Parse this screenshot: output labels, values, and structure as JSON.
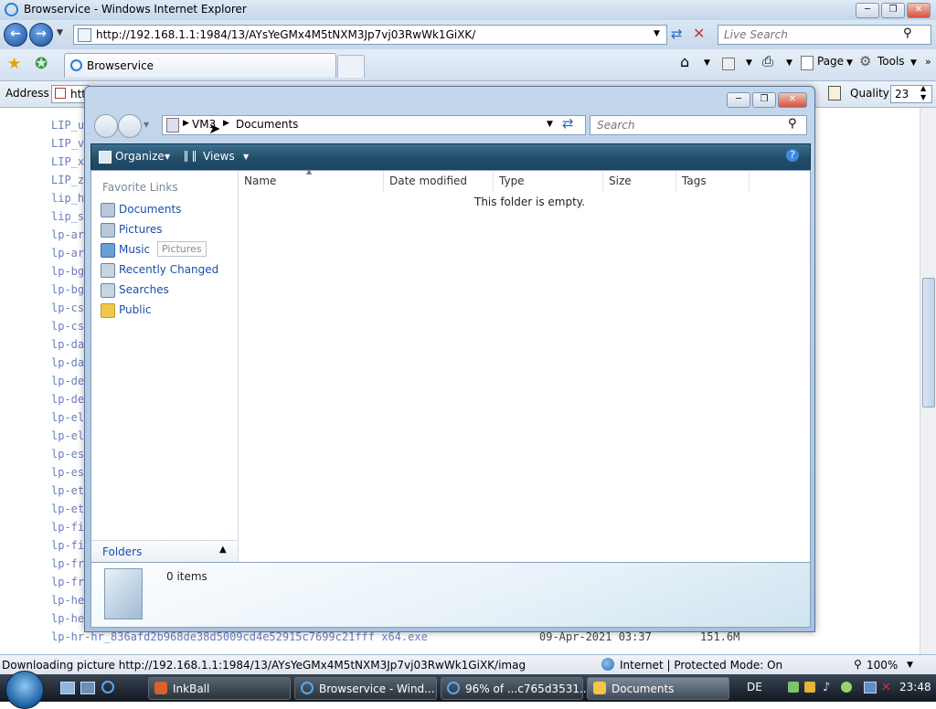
{
  "ie": {
    "title": "Browservice - Windows Internet Explorer",
    "url": "http://192.168.1.1:1984/13/AYsYeGMx4M5tNXM3Jp7vj03RwWk1GiXK/",
    "search_placeholder": "Live Search",
    "tab_label": "Browservice",
    "page_label": "Page",
    "tools_label": "Tools",
    "address_label": "Address",
    "address_value": "htt",
    "quality_label": "Quality",
    "quality_value": "23"
  },
  "listing": {
    "items": [
      "LIP_u",
      "LIP_v",
      "LIP_x",
      "LIP_z",
      "lip_h",
      "lip_s",
      "lp-ar",
      "lp-ar",
      "lp-bg",
      "lp-bg",
      "lp-cs",
      "lp-cs",
      "lp-da",
      "lp-da",
      "lp-de",
      "lp-de",
      "lp-el",
      "lp-el",
      "lp-es",
      "lp-es",
      "lp-et",
      "lp-et",
      "lp-fi",
      "lp-fi",
      "lp-fr",
      "lp-fr",
      "lp-he",
      "lp-he"
    ],
    "last_row": {
      "name": "lp-hr-hr_836afd2b968de38d5009cd4e52915c7699c21fff x64.exe",
      "date": "09-Apr-2021 03:37",
      "size": "151.6M"
    }
  },
  "status": {
    "text": "Downloading picture http://192.168.1.1:1984/13/AYsYeGMx4M5tNXM3Jp7vj03RwWk1GiXK/imag",
    "zone": "Internet | Protected Mode: On",
    "zoom": "100%"
  },
  "taskbar": {
    "tasks": [
      "InkBall",
      "Browservice - Wind...",
      "96% of ...c765d3531...",
      "Documents"
    ],
    "lang": "DE",
    "clock": "23:48"
  },
  "explorer": {
    "breadcrumb": [
      "VM3",
      "Documents"
    ],
    "search_placeholder": "Search",
    "organize_label": "Organize",
    "views_label": "Views",
    "favorite_links_title": "Favorite Links",
    "favorites": [
      "Documents",
      "Pictures",
      "Music",
      "Recently Changed",
      "Searches",
      "Public"
    ],
    "tooltip": "Pictures",
    "folders_label": "Folders",
    "columns": [
      "Name",
      "Date modified",
      "Type",
      "Size",
      "Tags"
    ],
    "empty_message": "This folder is empty.",
    "item_count": "0 items"
  }
}
